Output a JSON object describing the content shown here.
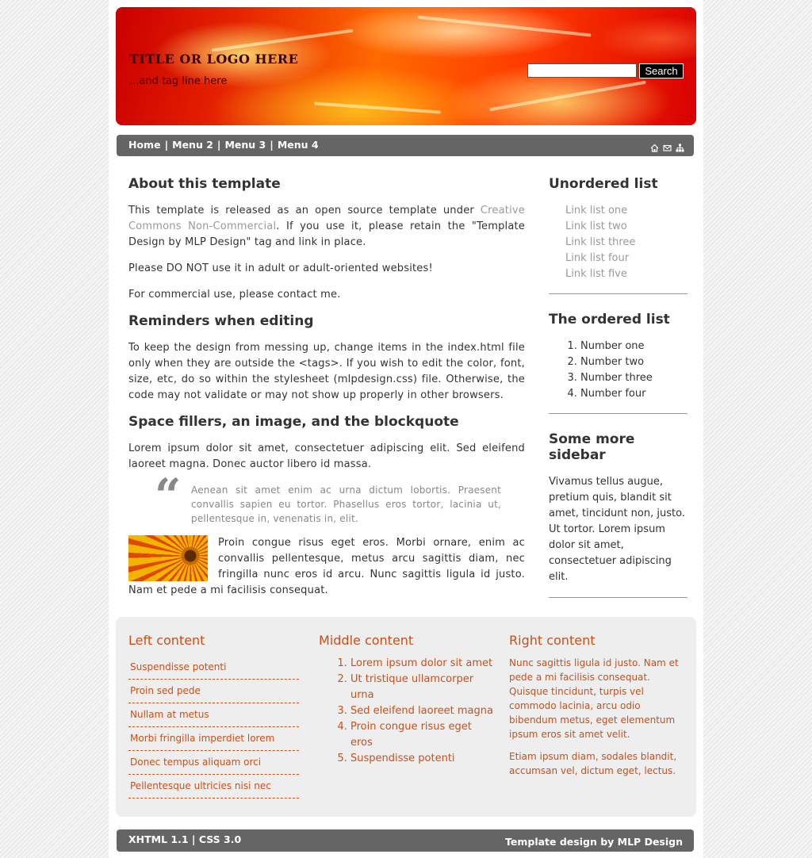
{
  "header": {
    "title": "TITLE OR LOGO HERE",
    "tagline": "...and tag line here",
    "search_value": "",
    "search_button": "Search"
  },
  "nav": {
    "items": [
      "Home",
      "Menu 2",
      "Menu 3",
      "Menu 4"
    ],
    "separator": "|",
    "icons": [
      "home-icon",
      "mail-icon",
      "sitemap-icon"
    ]
  },
  "main": {
    "about": {
      "heading": "About this template",
      "p1_before": "This template is released as an open source template under ",
      "p1_link": "Creative Commons Non-Commercial",
      "p1_after": ". If you use it, please retain the \"Template Design by MLP Design\" tag and link in place.",
      "p2": "Please DO NOT use it in adult or adult-oriented websites!",
      "p3": "For commercial use, please contact me."
    },
    "reminders": {
      "heading": "Reminders when editing",
      "p1": "To keep the design from messing up, change items in the index.html file only when they are outside the <tags>. If you wish to edit the color, font, size, etc, do so within the stylesheet (mlpdesign.css) file. Otherwise, the code may not validate or may not show up properly in other browsers."
    },
    "fillers": {
      "heading": "Space fillers, an image, and the blockquote",
      "p1": "Lorem ipsum dolor sit amet, consectetuer adipiscing elit. Sed eleifend laoreet magna. Donec auctor libero id massa.",
      "quote_mark": "“",
      "quote": "Aenean sit amet enim ac urna dictum lobortis. Praesent convallis sapien eu tortor. Phasellus eros tortor, lacinia ut, pellentesque in, venenatis in, elit.",
      "p2": "Proin congue risus eget eros. Morbi ornare, enim ac convallis pellentesque, metus arcu sagittis diam, nec fringilla nunc eros id arcu. Nunc sagittis ligula id justo. Nam et pede a mi facilisis consequat."
    }
  },
  "sidebar": {
    "unordered": {
      "heading": "Unordered list",
      "items": [
        "Link list one",
        "Link list two",
        "Link list three",
        "Link list four",
        "Link list five"
      ]
    },
    "ordered": {
      "heading": "The ordered list",
      "items": [
        "Number one",
        "Number two",
        "Number three",
        "Number four"
      ]
    },
    "more": {
      "heading": "Some more sidebar",
      "text": "Vivamus tellus augue, pretium quis, blandit sit amet, tincidunt non, justo. Ut tortor. Lorem ipsum dolor sit amet, consectetuer adipiscing elit."
    }
  },
  "footer_content": {
    "left": {
      "heading": "Left content",
      "items": [
        "Suspendisse potenti",
        "Proin sed pede",
        "Nullam at metus",
        "Morbi fringilla imperdiet lorem",
        "Donec tempus aliquam orci",
        "Pellentesque ultricies nisi nec"
      ]
    },
    "middle": {
      "heading": "Middle content",
      "items": [
        "Lorem ipsum dolor sit amet",
        "Ut tristique ullamcorper urna",
        "Sed eleifend laoreet magna",
        "Proin congue risus eget eros",
        "Suspendisse potenti"
      ]
    },
    "right": {
      "heading": "Right content",
      "p1": "Nunc sagittis ligula id justo. Nam et pede a mi facilisis consequat. Quisque tincidunt, turpis vel commodo lacinia, arcu odio bibendum metus, eget elementum ipsum eros sit amet velit.",
      "p2": "Etiam ipsum diam, sodales blandit, accumsan vel, dictum eget, lectus."
    }
  },
  "bottom": {
    "xhtml": "XHTML 1.1",
    "separator": "|",
    "css": "CSS 3.0",
    "credit": "Template design by MLP Design"
  },
  "colors": {
    "accent": "#c8501a",
    "nav_bg": "#656565",
    "link_gray": "#999999",
    "panel_bg": "#eeeeee"
  }
}
